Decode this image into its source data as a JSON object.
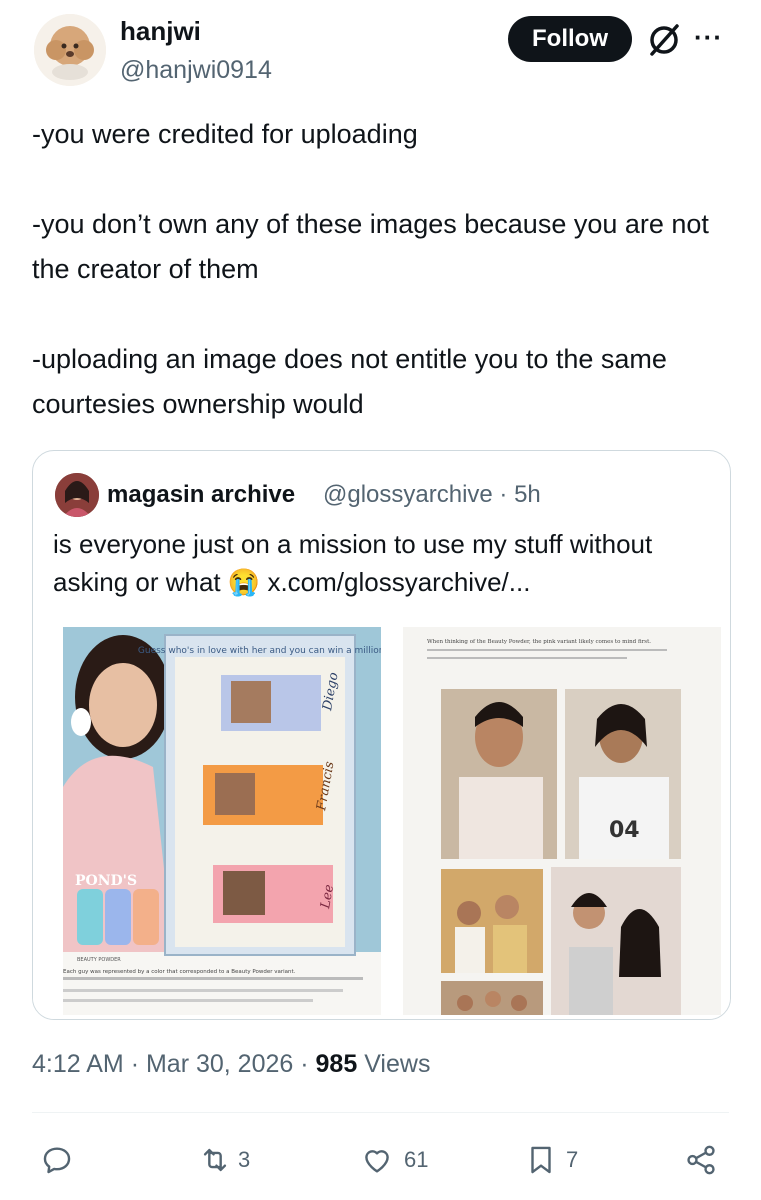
{
  "author": {
    "display_name": "hanjwi",
    "handle": "@hanjwi0914",
    "follow_label": "Follow"
  },
  "tweet": {
    "text": "-you were credited for uploading\n\n-you don’t own any of these images because you are not the creator of them\n\n-uploading an image does not entitle you to the same courtesies ownership would"
  },
  "quote": {
    "display_name": "magasin archive",
    "meta": "@glossyarchive · 5h",
    "text": "is everyone just on a mission to use my stuff without asking or what 😭 x.com/glossyarchive/...",
    "image_left": {
      "ad_headline": "Guess who's in love with her and you can win a million!",
      "brand": "POND'S",
      "brand_sub": "BEAUTY POWDER",
      "names": [
        "Diego",
        "Francis",
        "Lee"
      ],
      "caption": "Each guy was represented by a color that corresponded to a Beauty Powder variant."
    },
    "image_right": {
      "caption": "When thinking of the Beauty Powder, the pink variant likely comes to mind first."
    }
  },
  "footer": {
    "time": "4:12 AM",
    "date": "Mar 30, 2026",
    "views_count": "985",
    "views_label": "Views",
    "retweets": "3",
    "likes": "61",
    "bookmarks": "7"
  },
  "colors": {
    "text": "#0f1419",
    "secondary": "#536471",
    "border": "#cfd9de"
  }
}
